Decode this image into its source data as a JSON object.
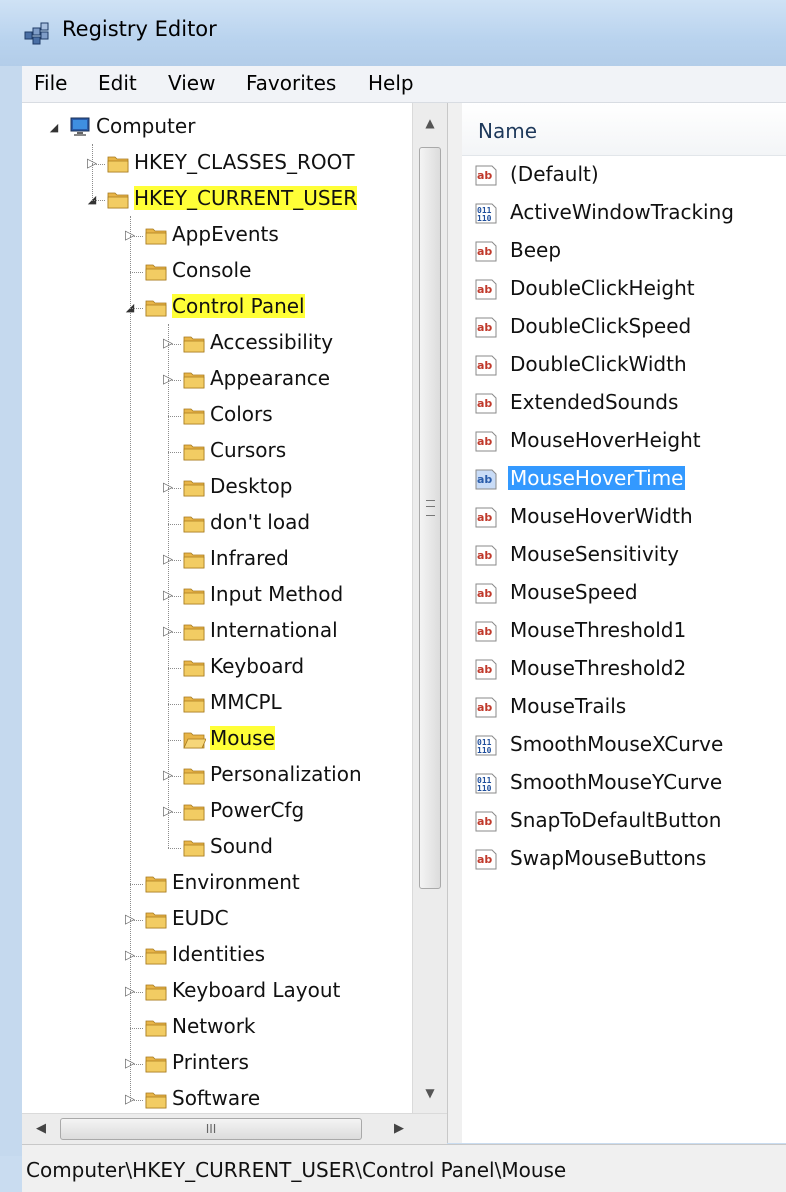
{
  "window": {
    "title": "Registry Editor"
  },
  "menu": [
    "File",
    "Edit",
    "View",
    "Favorites",
    "Help"
  ],
  "tree": {
    "nodes": [
      {
        "label": "Computer",
        "level": 0,
        "expander": "expanded",
        "icon": "computer-icon",
        "highlight": false
      },
      {
        "label": "HKEY_CLASSES_ROOT",
        "level": 1,
        "expander": "collapsed",
        "icon": "folder-icon",
        "highlight": false
      },
      {
        "label": "HKEY_CURRENT_USER",
        "level": 1,
        "expander": "expanded",
        "icon": "folder-icon",
        "highlight": true
      },
      {
        "label": "AppEvents",
        "level": 2,
        "expander": "collapsed",
        "icon": "folder-icon",
        "highlight": false
      },
      {
        "label": "Console",
        "level": 2,
        "expander": "none",
        "icon": "folder-icon",
        "highlight": false
      },
      {
        "label": "Control Panel",
        "level": 2,
        "expander": "expanded",
        "icon": "folder-icon",
        "highlight": true
      },
      {
        "label": "Accessibility",
        "level": 3,
        "expander": "collapsed",
        "icon": "folder-icon",
        "highlight": false
      },
      {
        "label": "Appearance",
        "level": 3,
        "expander": "collapsed",
        "icon": "folder-icon",
        "highlight": false
      },
      {
        "label": "Colors",
        "level": 3,
        "expander": "none",
        "icon": "folder-icon",
        "highlight": false
      },
      {
        "label": "Cursors",
        "level": 3,
        "expander": "none",
        "icon": "folder-icon",
        "highlight": false
      },
      {
        "label": "Desktop",
        "level": 3,
        "expander": "collapsed",
        "icon": "folder-icon",
        "highlight": false
      },
      {
        "label": "don't load",
        "level": 3,
        "expander": "none",
        "icon": "folder-icon",
        "highlight": false
      },
      {
        "label": "Infrared",
        "level": 3,
        "expander": "collapsed",
        "icon": "folder-icon",
        "highlight": false
      },
      {
        "label": "Input Method",
        "level": 3,
        "expander": "collapsed",
        "icon": "folder-icon",
        "highlight": false
      },
      {
        "label": "International",
        "level": 3,
        "expander": "collapsed",
        "icon": "folder-icon",
        "highlight": false
      },
      {
        "label": "Keyboard",
        "level": 3,
        "expander": "none",
        "icon": "folder-icon",
        "highlight": false
      },
      {
        "label": "MMCPL",
        "level": 3,
        "expander": "none",
        "icon": "folder-icon",
        "highlight": false
      },
      {
        "label": "Mouse",
        "level": 3,
        "expander": "none",
        "icon": "folder-open-icon",
        "highlight": true
      },
      {
        "label": "Personalization",
        "level": 3,
        "expander": "collapsed",
        "icon": "folder-icon",
        "highlight": false
      },
      {
        "label": "PowerCfg",
        "level": 3,
        "expander": "collapsed",
        "icon": "folder-icon",
        "highlight": false
      },
      {
        "label": "Sound",
        "level": 3,
        "expander": "none",
        "icon": "folder-icon",
        "highlight": false
      },
      {
        "label": "Environment",
        "level": 2,
        "expander": "none",
        "icon": "folder-icon",
        "highlight": false
      },
      {
        "label": "EUDC",
        "level": 2,
        "expander": "collapsed",
        "icon": "folder-icon",
        "highlight": false
      },
      {
        "label": "Identities",
        "level": 2,
        "expander": "collapsed",
        "icon": "folder-icon",
        "highlight": false
      },
      {
        "label": "Keyboard Layout",
        "level": 2,
        "expander": "collapsed",
        "icon": "folder-icon",
        "highlight": false
      },
      {
        "label": "Network",
        "level": 2,
        "expander": "none",
        "icon": "folder-icon",
        "highlight": false
      },
      {
        "label": "Printers",
        "level": 2,
        "expander": "collapsed",
        "icon": "folder-icon",
        "highlight": false
      },
      {
        "label": "Software",
        "level": 2,
        "expander": "collapsed",
        "icon": "folder-icon",
        "highlight": false
      }
    ],
    "hscroll_grip": "III"
  },
  "values_pane": {
    "column_name": "Name",
    "items": [
      {
        "label": "(Default)",
        "type": "string",
        "selected": false
      },
      {
        "label": "ActiveWindowTracking",
        "type": "binary",
        "selected": false
      },
      {
        "label": "Beep",
        "type": "string",
        "selected": false
      },
      {
        "label": "DoubleClickHeight",
        "type": "string",
        "selected": false
      },
      {
        "label": "DoubleClickSpeed",
        "type": "string",
        "selected": false
      },
      {
        "label": "DoubleClickWidth",
        "type": "string",
        "selected": false
      },
      {
        "label": "ExtendedSounds",
        "type": "string",
        "selected": false
      },
      {
        "label": "MouseHoverHeight",
        "type": "string",
        "selected": false
      },
      {
        "label": "MouseHoverTime",
        "type": "string",
        "selected": true
      },
      {
        "label": "MouseHoverWidth",
        "type": "string",
        "selected": false
      },
      {
        "label": "MouseSensitivity",
        "type": "string",
        "selected": false
      },
      {
        "label": "MouseSpeed",
        "type": "string",
        "selected": false
      },
      {
        "label": "MouseThreshold1",
        "type": "string",
        "selected": false
      },
      {
        "label": "MouseThreshold2",
        "type": "string",
        "selected": false
      },
      {
        "label": "MouseTrails",
        "type": "string",
        "selected": false
      },
      {
        "label": "SmoothMouseXCurve",
        "type": "binary",
        "selected": false
      },
      {
        "label": "SmoothMouseYCurve",
        "type": "binary",
        "selected": false
      },
      {
        "label": "SnapToDefaultButton",
        "type": "string",
        "selected": false
      },
      {
        "label": "SwapMouseButtons",
        "type": "string",
        "selected": false
      }
    ]
  },
  "status": {
    "path": "Computer\\HKEY_CURRENT_USER\\Control Panel\\Mouse"
  },
  "colors": {
    "highlight": "#ffff37",
    "selection": "#3399ff",
    "titlebar": "#b9d3ee"
  }
}
